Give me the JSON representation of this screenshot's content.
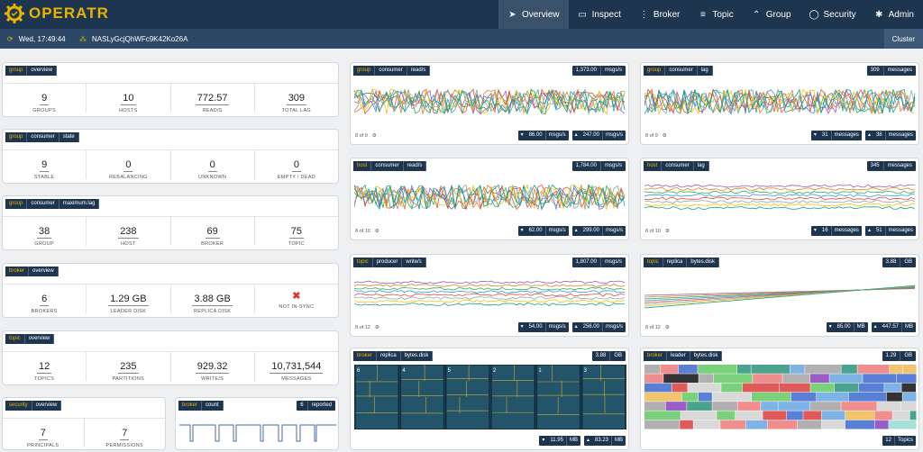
{
  "app": {
    "name": "OPERATR"
  },
  "nav": [
    {
      "label": "Overview",
      "icon": "send-icon",
      "glyph": "➤",
      "active": true
    },
    {
      "label": "Inspect",
      "icon": "folder-icon",
      "glyph": "▭"
    },
    {
      "label": "Broker",
      "icon": "more-vertical-icon",
      "glyph": "⋮"
    },
    {
      "label": "Topic",
      "icon": "list-icon",
      "glyph": "≡"
    },
    {
      "label": "Group",
      "icon": "chevrons-up-icon",
      "glyph": "⌃"
    },
    {
      "label": "Security",
      "icon": "user-icon",
      "glyph": "◯"
    },
    {
      "label": "Admin",
      "icon": "gear-icon",
      "glyph": "✱"
    }
  ],
  "subbar": {
    "time": "Wed, 17:49:44",
    "cluster_id": "NASLyGcjQhWFc9K42Ko26A",
    "cluster_button": "Cluster"
  },
  "cards": {
    "group_overview": {
      "tags": [
        "group",
        "overview"
      ],
      "stats": [
        {
          "value": "9",
          "label": "GROUPS"
        },
        {
          "value": "10",
          "label": "HOSTS"
        },
        {
          "value": "772.57",
          "label": "READ/S"
        },
        {
          "value": "309",
          "label": "TOTAL LAG"
        }
      ]
    },
    "group_state": {
      "tags": [
        "group",
        "consumer",
        "state"
      ],
      "stats": [
        {
          "value": "9",
          "label": "STABLE"
        },
        {
          "value": "0",
          "label": "REBALANCING"
        },
        {
          "value": "0",
          "label": "UNKNOWN"
        },
        {
          "value": "0",
          "label": "EMPTY / DEAD"
        }
      ]
    },
    "group_maxlag": {
      "tags": [
        "group",
        "consumer",
        "maximum.lag"
      ],
      "stats": [
        {
          "value": "38",
          "label": "GROUP"
        },
        {
          "value": "238",
          "label": "HOST"
        },
        {
          "value": "69",
          "label": "BROKER"
        },
        {
          "value": "75",
          "label": "TOPIC"
        }
      ]
    },
    "broker_overview": {
      "tags": [
        "broker",
        "overview"
      ],
      "stats": [
        {
          "value": "6",
          "label": "BROKERS"
        },
        {
          "value": "1.29 GB",
          "label": "LEADER DISK"
        },
        {
          "value": "3.88 GB",
          "label": "REPLICA DISK"
        },
        {
          "value": "✖",
          "label": "NOT IN-SYNC"
        }
      ]
    },
    "topic_overview": {
      "tags": [
        "topic",
        "overview"
      ],
      "stats": [
        {
          "value": "12",
          "label": "TOPICS"
        },
        {
          "value": "235",
          "label": "PARTITIONS"
        },
        {
          "value": "929.32",
          "label": "WRITE/S"
        },
        {
          "value": "10,731,544",
          "label": "MESSAGES"
        }
      ]
    },
    "security_overview": {
      "tags": [
        "security",
        "overview"
      ],
      "stats": [
        {
          "value": "7",
          "label": "PRINCIPALS"
        },
        {
          "value": "7",
          "label": "PERMISSIONS"
        }
      ]
    },
    "broker_count": {
      "tags": [
        "broker",
        "count"
      ],
      "badge_value": "6",
      "badge_unit": "reported"
    }
  },
  "charts": {
    "group_consumer_read": {
      "tags": [
        "group",
        "consumer",
        "read/s"
      ],
      "total": "1,373.00",
      "unit": "msgs/s",
      "footer": "8 of 9",
      "min": "86.00",
      "max": "247.00"
    },
    "group_consumer_lag": {
      "tags": [
        "group",
        "consumer",
        "lag"
      ],
      "total": "309",
      "unit": "messages",
      "footer": "8 of 9",
      "min": "31",
      "max": "38"
    },
    "host_consumer_read": {
      "tags": [
        "host",
        "consumer",
        "read/s"
      ],
      "total": "1,784.00",
      "unit": "msgs/s",
      "footer": "8 of 10",
      "min": "62.00",
      "max": "299.00"
    },
    "host_consumer_lag": {
      "tags": [
        "host",
        "consumer",
        "lag"
      ],
      "total": "345",
      "unit": "messages",
      "footer": "8 of 10",
      "min": "16",
      "max": "51"
    },
    "topic_producer_write": {
      "tags": [
        "topic",
        "producer",
        "write/s"
      ],
      "total": "1,807.00",
      "unit": "msgs/s",
      "footer": "8 of 12",
      "min": "54.00",
      "max": "256.00"
    },
    "topic_replica_disk": {
      "tags": [
        "topic",
        "replica",
        "bytes.disk"
      ],
      "total": "3.88",
      "unit": "GB",
      "footer": "8 of 12",
      "min": "85.00",
      "min_unit": "MB",
      "max": "447.57",
      "max_unit": "MB"
    },
    "broker_replica_disk": {
      "tags": [
        "broker",
        "replica",
        "bytes.disk"
      ],
      "total": "3.88",
      "unit": "GB",
      "min": "11.95",
      "min_unit": "MB",
      "max": "83.23",
      "max_unit": "MB",
      "columns": [
        "6",
        "4",
        "5",
        "2",
        "1",
        "3"
      ]
    },
    "broker_leader_disk": {
      "tags": [
        "broker",
        "leader",
        "bytes.disk"
      ],
      "total": "1.29",
      "unit": "GB",
      "footer_value": "12",
      "footer_unit": "Topics"
    }
  },
  "colors": {
    "navy": "#1e3550",
    "gold": "#e8b400",
    "treemap": "#24546a",
    "treemap_line": "#c9b13a"
  }
}
